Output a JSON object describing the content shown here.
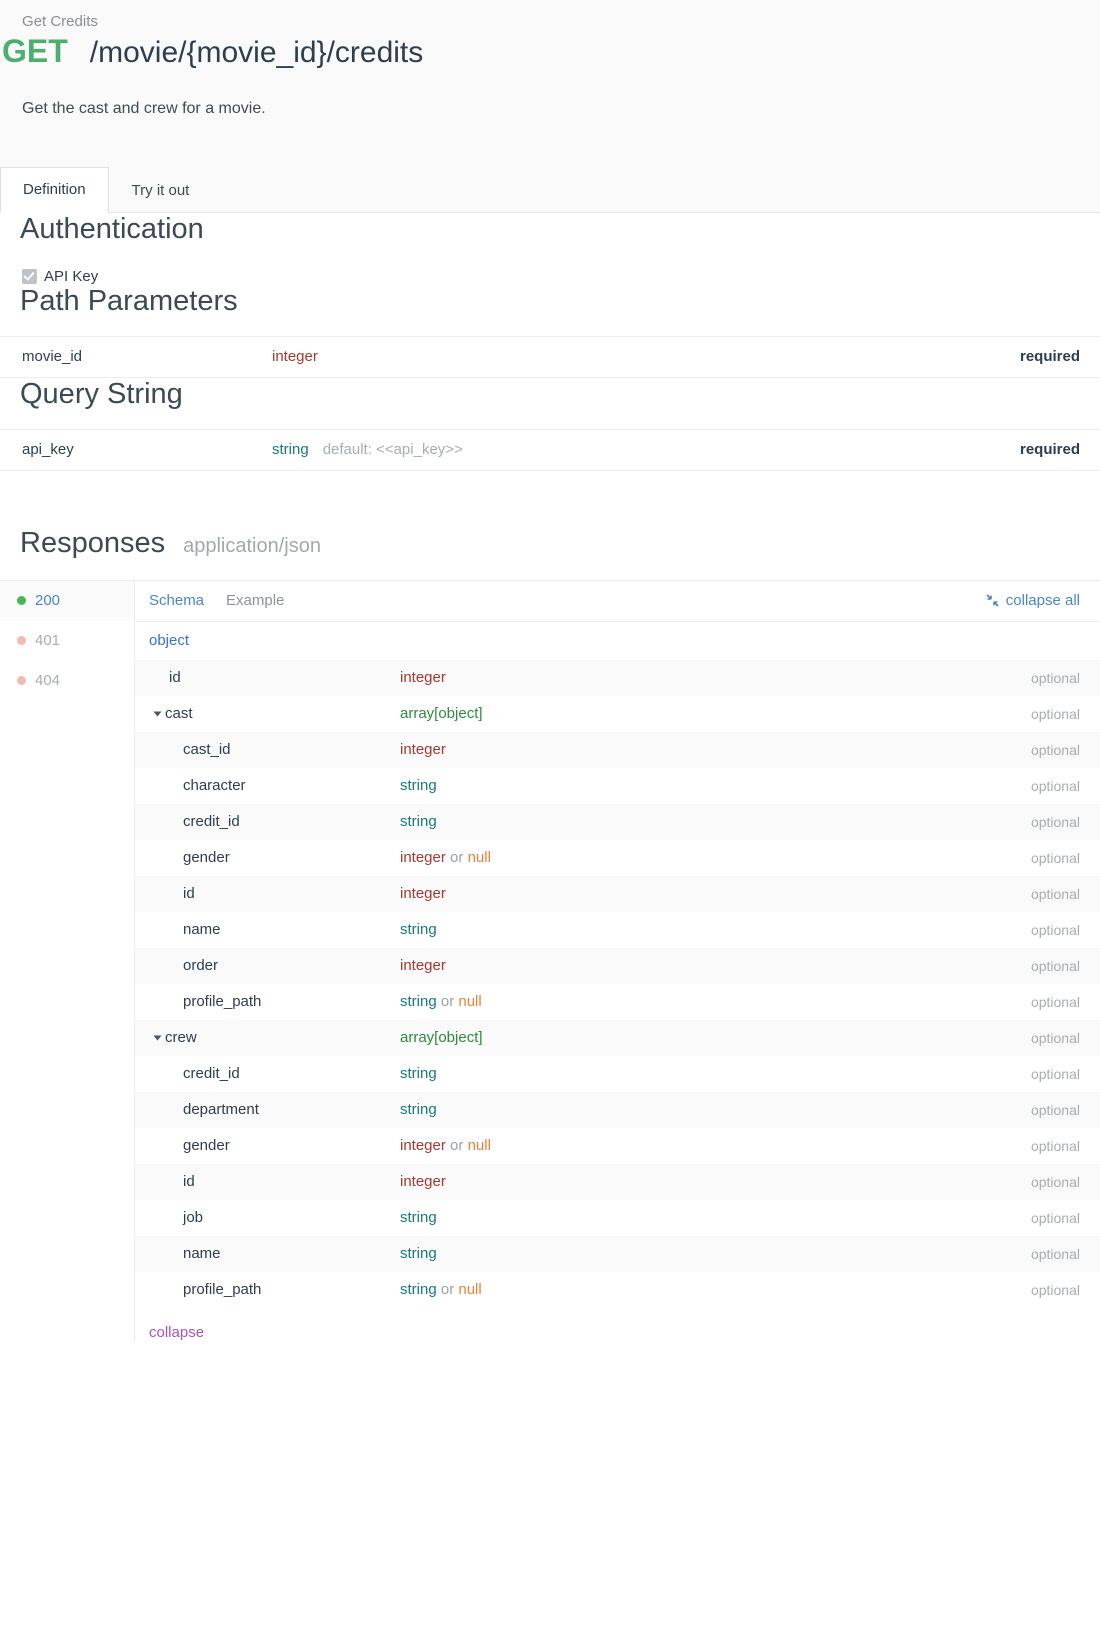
{
  "header": {
    "operation_name": "Get Credits",
    "method": "GET",
    "path": "/movie/{movie_id}/credits",
    "description": "Get the cast and crew for a movie.",
    "method_color": "#4caf6d"
  },
  "tabs": [
    {
      "label": "Definition",
      "active": true
    },
    {
      "label": "Try it out",
      "active": false
    }
  ],
  "authentication": {
    "title": "Authentication",
    "items": [
      {
        "label": "API Key",
        "checked": true
      }
    ]
  },
  "path_parameters": {
    "title": "Path Parameters",
    "rows": [
      {
        "name": "movie_id",
        "type": "integer",
        "type_class": "integer",
        "default": "",
        "required_label": "required"
      }
    ]
  },
  "query_string": {
    "title": "Query String",
    "rows": [
      {
        "name": "api_key",
        "type": "string",
        "type_class": "string",
        "default": "default: <<api_key>>",
        "required_label": "required"
      }
    ]
  },
  "responses": {
    "title": "Responses",
    "mime": "application/json",
    "codes": [
      {
        "code": "200",
        "status": "active",
        "dot": "green"
      },
      {
        "code": "401",
        "status": "idle",
        "dot": "pink"
      },
      {
        "code": "404",
        "status": "idle",
        "dot": "pink"
      }
    ],
    "schema_tabs": [
      {
        "label": "Schema",
        "active": true
      },
      {
        "label": "Example",
        "active": false
      }
    ],
    "collapse_all_label": "collapse all",
    "root_type": "object",
    "collapse_label": "collapse",
    "optional_label": "optional",
    "tree": [
      {
        "name": "id",
        "indent": 1,
        "expandable": false,
        "type": "integer",
        "type_class": "integer",
        "nullable": false,
        "optional": "optional"
      },
      {
        "name": "cast",
        "indent": 1,
        "expandable": true,
        "type": "array[object]",
        "type_class": "array",
        "nullable": false,
        "optional": "optional"
      },
      {
        "name": "cast_id",
        "indent": 2,
        "expandable": false,
        "type": "integer",
        "type_class": "integer",
        "nullable": false,
        "optional": "optional"
      },
      {
        "name": "character",
        "indent": 2,
        "expandable": false,
        "type": "string",
        "type_class": "string",
        "nullable": false,
        "optional": "optional"
      },
      {
        "name": "credit_id",
        "indent": 2,
        "expandable": false,
        "type": "string",
        "type_class": "string",
        "nullable": false,
        "optional": "optional"
      },
      {
        "name": "gender",
        "indent": 2,
        "expandable": false,
        "type": "integer",
        "type_class": "integer",
        "nullable": true,
        "optional": "optional"
      },
      {
        "name": "id",
        "indent": 2,
        "expandable": false,
        "type": "integer",
        "type_class": "integer",
        "nullable": false,
        "optional": "optional"
      },
      {
        "name": "name",
        "indent": 2,
        "expandable": false,
        "type": "string",
        "type_class": "string",
        "nullable": false,
        "optional": "optional"
      },
      {
        "name": "order",
        "indent": 2,
        "expandable": false,
        "type": "integer",
        "type_class": "integer",
        "nullable": false,
        "optional": "optional"
      },
      {
        "name": "profile_path",
        "indent": 2,
        "expandable": false,
        "type": "string",
        "type_class": "string",
        "nullable": true,
        "optional": "optional"
      },
      {
        "name": "crew",
        "indent": 1,
        "expandable": true,
        "type": "array[object]",
        "type_class": "array",
        "nullable": false,
        "optional": "optional"
      },
      {
        "name": "credit_id",
        "indent": 2,
        "expandable": false,
        "type": "string",
        "type_class": "string",
        "nullable": false,
        "optional": "optional"
      },
      {
        "name": "department",
        "indent": 2,
        "expandable": false,
        "type": "string",
        "type_class": "string",
        "nullable": false,
        "optional": "optional"
      },
      {
        "name": "gender",
        "indent": 2,
        "expandable": false,
        "type": "integer",
        "type_class": "integer",
        "nullable": true,
        "optional": "optional"
      },
      {
        "name": "id",
        "indent": 2,
        "expandable": false,
        "type": "integer",
        "type_class": "integer",
        "nullable": false,
        "optional": "optional"
      },
      {
        "name": "job",
        "indent": 2,
        "expandable": false,
        "type": "string",
        "type_class": "string",
        "nullable": false,
        "optional": "optional"
      },
      {
        "name": "name",
        "indent": 2,
        "expandable": false,
        "type": "string",
        "type_class": "string",
        "nullable": false,
        "optional": "optional"
      },
      {
        "name": "profile_path",
        "indent": 2,
        "expandable": false,
        "type": "string",
        "type_class": "string",
        "nullable": true,
        "optional": "optional"
      }
    ],
    "null_word": "null",
    "or_word": "or"
  }
}
